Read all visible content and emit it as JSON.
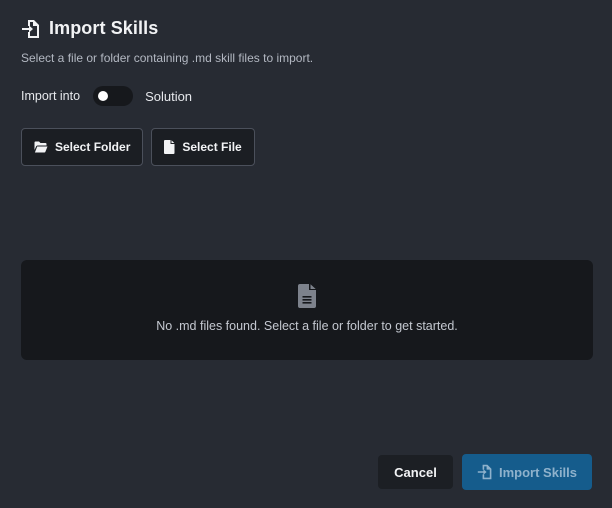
{
  "dialog": {
    "title": "Import Skills",
    "title_icon": "file-import-icon",
    "subtitle": "Select a file or folder containing .md skill files to import."
  },
  "import_into": {
    "label": "Import into",
    "toggle_on": false,
    "value": "Solution"
  },
  "source_buttons": {
    "folder": {
      "label": "Select Folder",
      "icon": "folder-open-icon"
    },
    "file": {
      "label": "Select File",
      "icon": "file-icon"
    }
  },
  "empty_state": {
    "icon": "file-lines-icon",
    "message": "No .md files found. Select a file or folder to get started."
  },
  "footer": {
    "cancel_label": "Cancel",
    "import_label": "Import Skills",
    "import_icon": "file-import-icon",
    "import_enabled": false
  },
  "colors": {
    "background": "#272b33",
    "panel": "#16181c",
    "primary_button": "#155c8c",
    "primary_text_disabled": "#8fb2cc"
  }
}
